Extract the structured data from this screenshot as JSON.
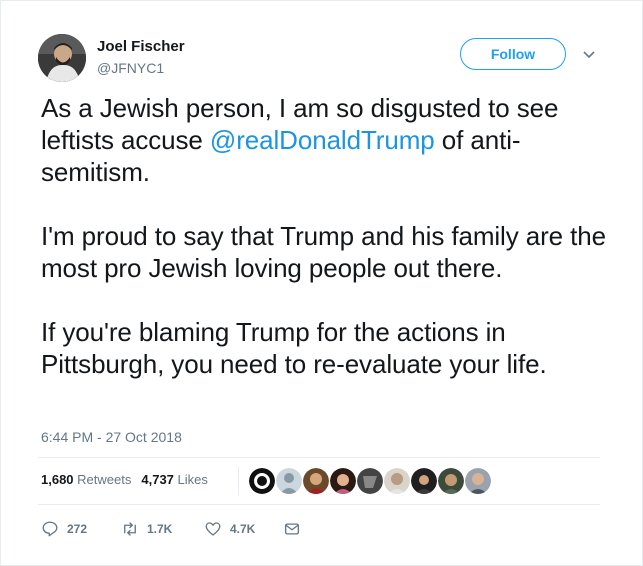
{
  "author": {
    "display_name": "Joel Fischer",
    "handle": "@JFNYC1"
  },
  "header": {
    "follow_label": "Follow",
    "menu_icon": "chevron-down-icon"
  },
  "tweet": {
    "para1_before": "As a Jewish person, I am so disgusted to see leftists accuse ",
    "mention": "@realDonaldTrump",
    "para1_after": " of anti-semitism.",
    "para2": "I'm proud to say that Trump and his family are the most pro Jewish loving people out there.",
    "para3": "If you're blaming Trump for the actions in Pittsburgh, you need to re-evaluate your life.",
    "timestamp": "6:44 PM - 27 Oct 2018"
  },
  "stats": {
    "retweets_count": "1,680",
    "retweets_label": "Retweets",
    "likes_count": "4,737",
    "likes_label": "Likes"
  },
  "actions": {
    "reply_count": "272",
    "retweet_count": "1.7K",
    "like_count": "4.7K"
  },
  "colors": {
    "accent": "#1da1f2",
    "text": "#14171a",
    "muted": "#657786",
    "border": "#e6ecf0"
  }
}
